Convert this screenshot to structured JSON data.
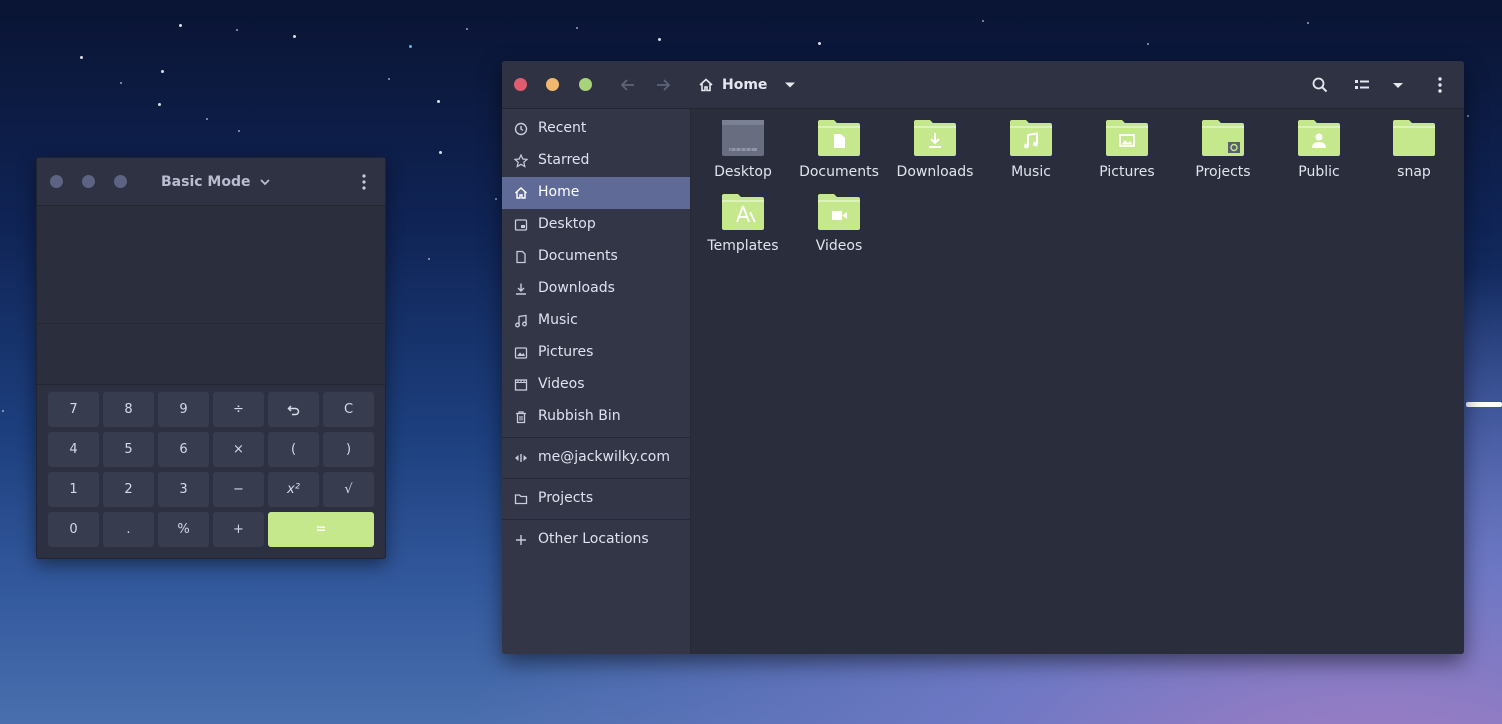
{
  "calculator": {
    "mode_label": "Basic Mode",
    "keys": [
      "7",
      "8",
      "9",
      "÷",
      "↺",
      "C",
      "4",
      "5",
      "6",
      "×",
      "(",
      ")",
      "1",
      "2",
      "3",
      "−",
      "x²",
      "√",
      "0",
      ".",
      "%",
      "+",
      "="
    ],
    "accent_color": "#c5e88d"
  },
  "file_manager": {
    "breadcrumb": "Home",
    "sidebar": {
      "items": [
        {
          "label": "Recent",
          "icon": "clock-icon"
        },
        {
          "label": "Starred",
          "icon": "star-icon"
        },
        {
          "label": "Home",
          "icon": "home-icon",
          "active": true
        },
        {
          "label": "Desktop",
          "icon": "desktop-icon"
        },
        {
          "label": "Documents",
          "icon": "document-icon"
        },
        {
          "label": "Downloads",
          "icon": "download-icon"
        },
        {
          "label": "Music",
          "icon": "music-icon"
        },
        {
          "label": "Pictures",
          "icon": "picture-icon"
        },
        {
          "label": "Videos",
          "icon": "video-icon"
        },
        {
          "label": "Rubbish Bin",
          "icon": "trash-icon"
        },
        {
          "label": "me@jackwilky.com",
          "icon": "network-icon"
        },
        {
          "label": "Projects",
          "icon": "folder-icon"
        },
        {
          "label": "Other Locations",
          "icon": "plus-icon"
        }
      ]
    },
    "files": [
      {
        "name": "Desktop",
        "icon": "desktop-folder-icon"
      },
      {
        "name": "Documents",
        "icon": "documents-folder-icon"
      },
      {
        "name": "Downloads",
        "icon": "downloads-folder-icon"
      },
      {
        "name": "Music",
        "icon": "music-folder-icon"
      },
      {
        "name": "Pictures",
        "icon": "pictures-folder-icon"
      },
      {
        "name": "Projects",
        "icon": "projects-folder-icon"
      },
      {
        "name": "Public",
        "icon": "public-folder-icon"
      },
      {
        "name": "snap",
        "icon": "snap-folder-icon"
      },
      {
        "name": "Templates",
        "icon": "templates-folder-icon"
      },
      {
        "name": "Videos",
        "icon": "videos-folder-icon"
      }
    ],
    "folder_color": "#c5e88d",
    "active_color": "#5f6a96"
  }
}
